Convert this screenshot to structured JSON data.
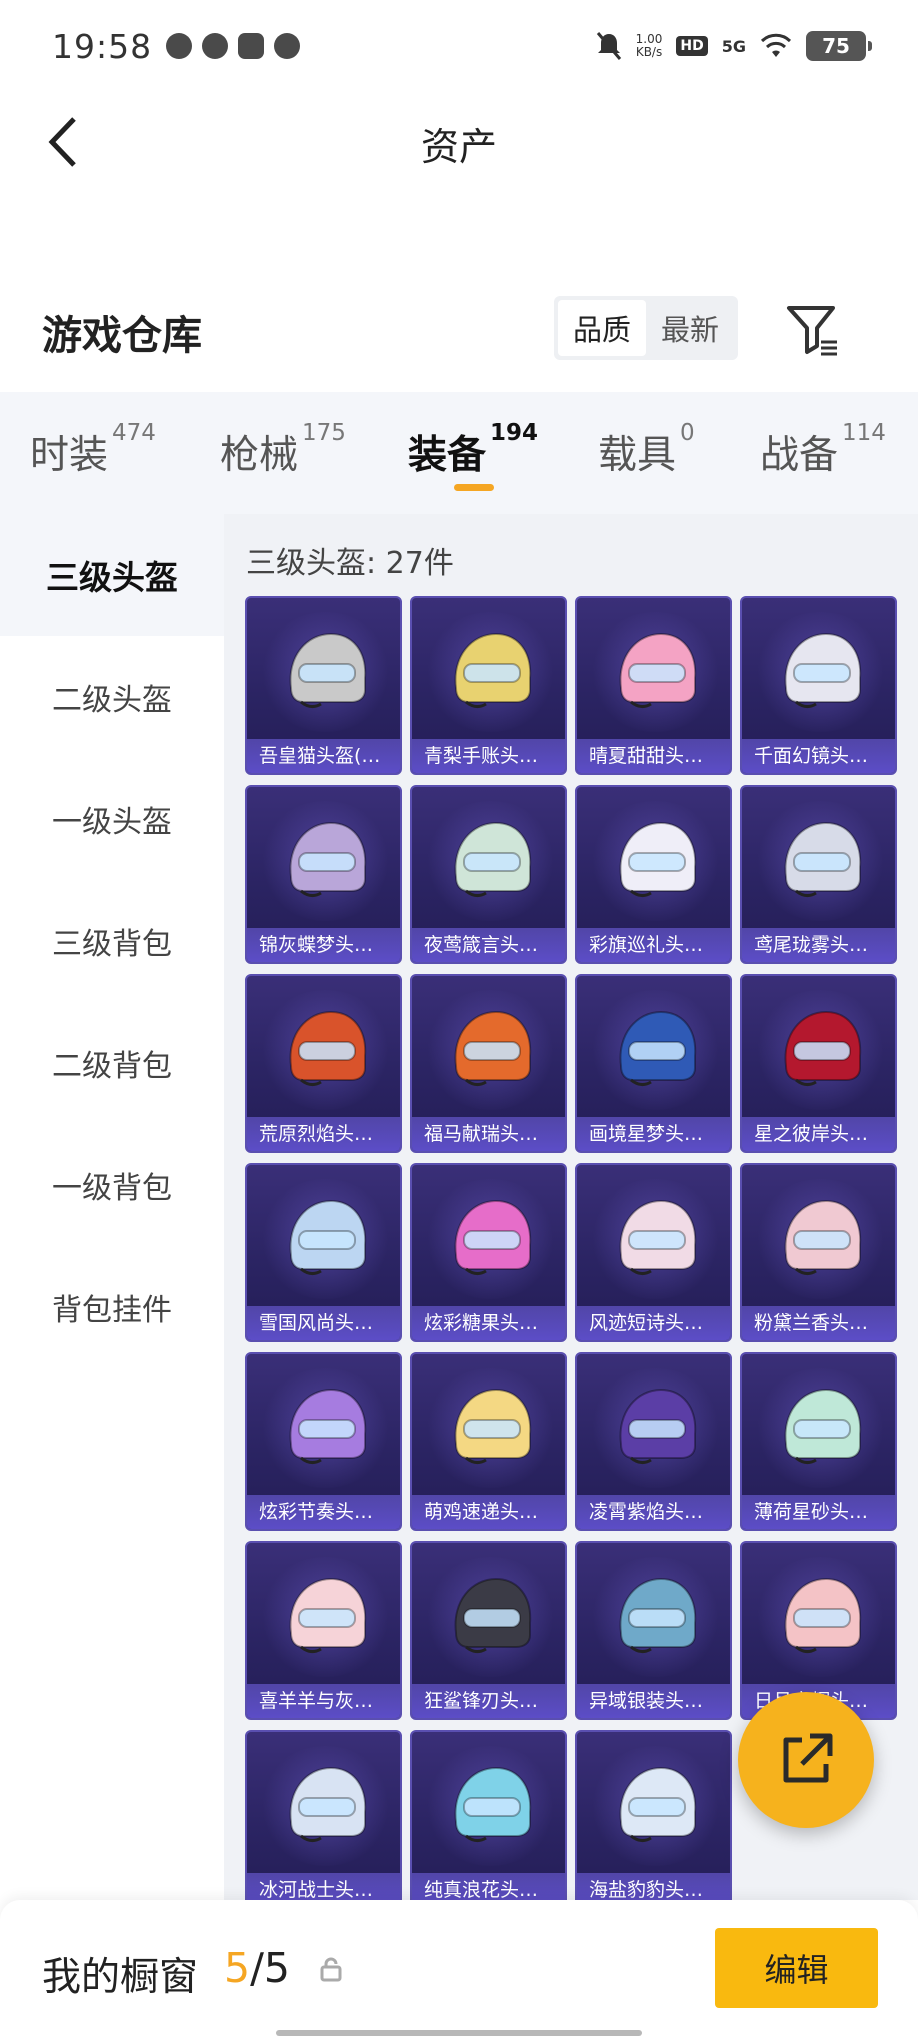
{
  "status_bar": {
    "time": "19:58",
    "speed_value": "1.00",
    "speed_unit": "KB/s",
    "hd": "HD",
    "network": "5G",
    "battery": "75",
    "left_icons": [
      "wechat-icon",
      "app-icon",
      "box-icon",
      "message-icon"
    ],
    "right_icons": [
      "mute-icon",
      "wifi-icon"
    ]
  },
  "header": {
    "title": "资产",
    "back_icon": "chevron-left-icon"
  },
  "warehouse": {
    "title": "游戏仓库",
    "sort_options": [
      "品质",
      "最新"
    ],
    "active_sort": "品质",
    "filter_icon": "filter-icon"
  },
  "tabs": [
    {
      "label": "时装",
      "count": "474"
    },
    {
      "label": "枪械",
      "count": "175"
    },
    {
      "label": "装备",
      "count": "194",
      "active": true
    },
    {
      "label": "载具",
      "count": "0"
    },
    {
      "label": "战备",
      "count": "114"
    }
  ],
  "sidebar": {
    "items": [
      "三级头盔",
      "二级头盔",
      "一级头盔",
      "三级背包",
      "二级背包",
      "一级背包",
      "背包挂件"
    ],
    "active": "三级头盔"
  },
  "main": {
    "section_title": "三级头盔: 27件",
    "items": [
      {
        "name": "吾皇猫头盔(…",
        "color": "#c9c9c9"
      },
      {
        "name": "青梨手账头…",
        "color": "#e8d270"
      },
      {
        "name": "晴夏甜甜头…",
        "color": "#f4a3c4"
      },
      {
        "name": "千面幻镜头…",
        "color": "#e6e6f0"
      },
      {
        "name": "锦灰蝶梦头…",
        "color": "#b9a6d9"
      },
      {
        "name": "夜莺箴言头…",
        "color": "#cfe5d8"
      },
      {
        "name": "彩旗巡礼头…",
        "color": "#efeef8"
      },
      {
        "name": "鸢尾珑雾头…",
        "color": "#d7dbe8"
      },
      {
        "name": "荒原烈焰头…",
        "color": "#d9532b"
      },
      {
        "name": "福马献瑞头…",
        "color": "#e46a2c"
      },
      {
        "name": "画境星梦头…",
        "color": "#2f5ab6"
      },
      {
        "name": "星之彼岸头…",
        "color": "#b4182e"
      },
      {
        "name": "雪国风尚头…",
        "color": "#bcd6f2"
      },
      {
        "name": "炫彩糖果头…",
        "color": "#e66dc9"
      },
      {
        "name": "风迹短诗头…",
        "color": "#f1dbe6"
      },
      {
        "name": "粉黛兰香头…",
        "color": "#f0c9d2"
      },
      {
        "name": "炫彩节奏头…",
        "color": "#a67ce0"
      },
      {
        "name": "萌鸡速递头…",
        "color": "#f4d883"
      },
      {
        "name": "凌霄紫焰头…",
        "color": "#5b3ea6"
      },
      {
        "name": "薄荷星砂头…",
        "color": "#bfe8d8"
      },
      {
        "name": "喜羊羊与灰…",
        "color": "#f6d3d8"
      },
      {
        "name": "狂鲨锋刃头…",
        "color": "#3b3b46"
      },
      {
        "name": "异域银装头…",
        "color": "#6fa9c9"
      },
      {
        "name": "日月启辉头…",
        "color": "#f4c3c6"
      },
      {
        "name": "冰河战士头…",
        "color": "#d8e3f3"
      },
      {
        "name": "纯真浪花头…",
        "color": "#7fd2e8"
      },
      {
        "name": "海盐豹豹头…",
        "color": "#dde8f6"
      }
    ]
  },
  "fab": {
    "icon": "share-icon"
  },
  "bottom_bar": {
    "label": "我的橱窗",
    "count_current": "5",
    "count_separator": "/",
    "count_total": "5",
    "lock_icon": "lock-icon",
    "edit_label": "编辑"
  },
  "colors": {
    "accent": "#f5a623",
    "edit_button": "#f9b90f",
    "card_background": "#2b2463"
  }
}
